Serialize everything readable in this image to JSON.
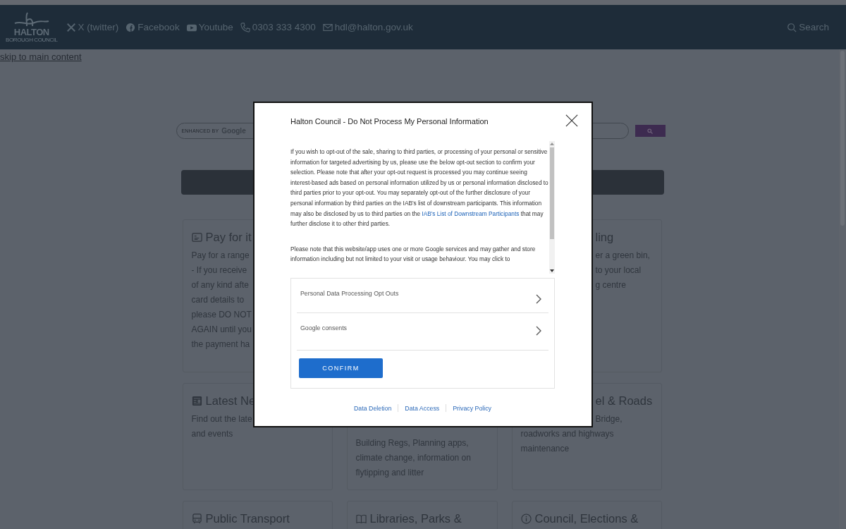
{
  "header": {
    "logo": {
      "name": "HALTON",
      "tagline": "BOROUGH COUNCIL"
    },
    "links": [
      {
        "kind": "x",
        "label": "X (twitter)"
      },
      {
        "kind": "facebook",
        "label": "Facebook"
      },
      {
        "kind": "youtube",
        "label": "Youtube"
      },
      {
        "kind": "phone",
        "label": "0303 333 4300"
      },
      {
        "kind": "email",
        "label": "hdl@halton.gov.uk"
      }
    ],
    "search": "Search"
  },
  "skip_link": "skip to main content",
  "site_search": {
    "prefix": "ENHANCED BY",
    "brand": "Google"
  },
  "card_rows": [
    [
      {
        "title": "Pay for it",
        "lines": [
          "Pay for a range",
          "- If you receive",
          "of any kind afte",
          "card details to",
          "please DO NOT",
          "AGAIN until you",
          "the payment ha"
        ]
      },
      {
        "title": "ling",
        "lines": [
          "er a green bin,",
          "to your local",
          "g centre"
        ]
      }
    ],
    [
      {
        "title": "Latest Ne",
        "lines": [
          "Find out the late",
          "and events"
        ]
      },
      {
        "lines": [
          "Building Regs, Planning apps,",
          "climate change, information on",
          "flytipping and litter"
        ]
      },
      {
        "title": "el & Roads",
        "lines": [
          "Bridge,",
          "roadworks and highways",
          "maintenance"
        ]
      }
    ],
    [
      {
        "title": "Public Transport"
      },
      {
        "title": "Libraries, Parks &"
      },
      {
        "title": "Council, Elections &"
      }
    ]
  ],
  "modal": {
    "title": "Halton Council - Do Not Process My Personal Information",
    "paragraph_1": {
      "before": "If you wish to opt-out of the sale, sharing to third parties, or processing of your personal or sensitive information for targeted advertising by us, please use the below opt-out section to confirm your selection. Please note that after your opt-out request is processed you may continue seeing interest-based ads based on personal information utilized by us or personal information disclosed to third parties prior to your opt-out. You may separately opt-out of the further disclosure of your personal information by third parties on the IAB's list of downstream participants. This information may also be disclosed by us to third parties on the",
      "link": "IAB's List of Downstream Participants",
      "after": "that may further disclose it to other third parties."
    },
    "paragraph_2": "Please note that this website/app uses one or more Google services and may gather and store information including but not limited to your visit or usage behaviour. You may click to",
    "sections": [
      "Personal Data Processing Opt Outs",
      "Google consents"
    ],
    "confirm": "CONFIRM",
    "footer_links": [
      "Data Deletion",
      "Data Access",
      "Privacy Policy"
    ]
  }
}
